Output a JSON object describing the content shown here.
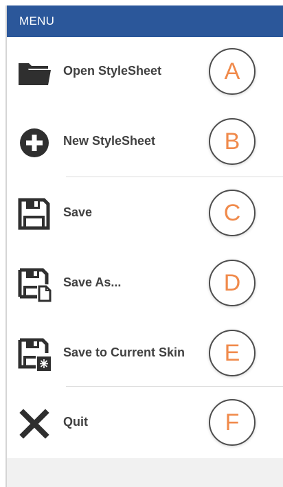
{
  "menu": {
    "title": "MENU",
    "accent_color": "#2b579a",
    "badge_color": "#f08a4b",
    "items": [
      {
        "label": "Open StyleSheet",
        "icon": "folder-icon",
        "badge": "A"
      },
      {
        "label": "New StyleSheet",
        "icon": "plus-circle-icon",
        "badge": "B"
      },
      {
        "label": "Save",
        "icon": "save-icon",
        "badge": "C"
      },
      {
        "label": "Save As...",
        "icon": "save-as-icon",
        "badge": "D"
      },
      {
        "label": "Save to Current Skin",
        "icon": "save-skin-icon",
        "badge": "E"
      },
      {
        "label": "Quit",
        "icon": "close-icon",
        "badge": "F"
      }
    ]
  }
}
